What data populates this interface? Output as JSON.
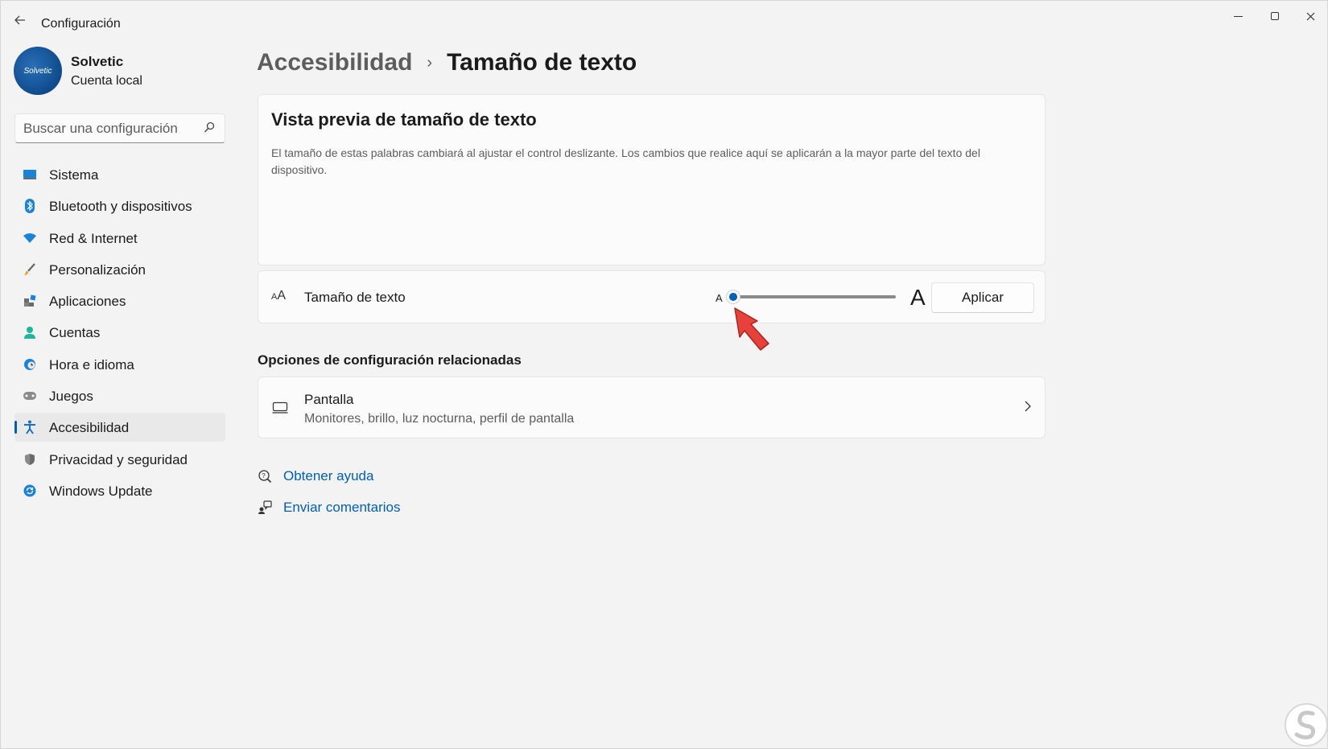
{
  "window": {
    "title": "Configuración",
    "controls": {
      "minimize": "minimize-icon",
      "maximize": "maximize-icon",
      "close": "close-icon"
    }
  },
  "profile": {
    "avatar_text": "Solvetic",
    "name": "Solvetic",
    "account_type": "Cuenta local"
  },
  "search": {
    "placeholder": "Buscar una configuración",
    "value": ""
  },
  "sidebar": {
    "items": [
      {
        "label": "Sistema",
        "icon": "system-icon",
        "active": false
      },
      {
        "label": "Bluetooth y dispositivos",
        "icon": "bluetooth-icon",
        "active": false
      },
      {
        "label": "Red & Internet",
        "icon": "wifi-icon",
        "active": false
      },
      {
        "label": "Personalización",
        "icon": "brush-icon",
        "active": false
      },
      {
        "label": "Aplicaciones",
        "icon": "apps-icon",
        "active": false
      },
      {
        "label": "Cuentas",
        "icon": "person-icon",
        "active": false
      },
      {
        "label": "Hora e idioma",
        "icon": "globe-clock-icon",
        "active": false
      },
      {
        "label": "Juegos",
        "icon": "gamepad-icon",
        "active": false
      },
      {
        "label": "Accesibilidad",
        "icon": "accessibility-icon",
        "active": true
      },
      {
        "label": "Privacidad y seguridad",
        "icon": "shield-icon",
        "active": false
      },
      {
        "label": "Windows Update",
        "icon": "update-icon",
        "active": false
      }
    ]
  },
  "breadcrumb": {
    "parent": "Accesibilidad",
    "separator": "›",
    "current": "Tamaño de texto"
  },
  "preview": {
    "title": "Vista previa de tamaño de texto",
    "description": "El tamaño de estas palabras cambiará al ajustar el control deslizante. Los cambios que realice aquí se aplicarán a la mayor parte del texto del dispositivo."
  },
  "text_size": {
    "icon_big": "A",
    "icon_small": "A",
    "label": "Tamaño de texto",
    "min_label": "A",
    "max_label": "A",
    "slider_value_fraction": 0.0,
    "apply_label": "Aplicar"
  },
  "related": {
    "heading": "Opciones de configuración relacionadas",
    "items": [
      {
        "title": "Pantalla",
        "subtitle": "Monitores, brillo, luz nocturna, perfil de pantalla",
        "icon": "monitor-icon"
      }
    ]
  },
  "links": {
    "help": "Obtener ayuda",
    "feedback": "Enviar comentarios"
  },
  "colors": {
    "accent": "#005fb8",
    "pointer": "#e8413c"
  }
}
